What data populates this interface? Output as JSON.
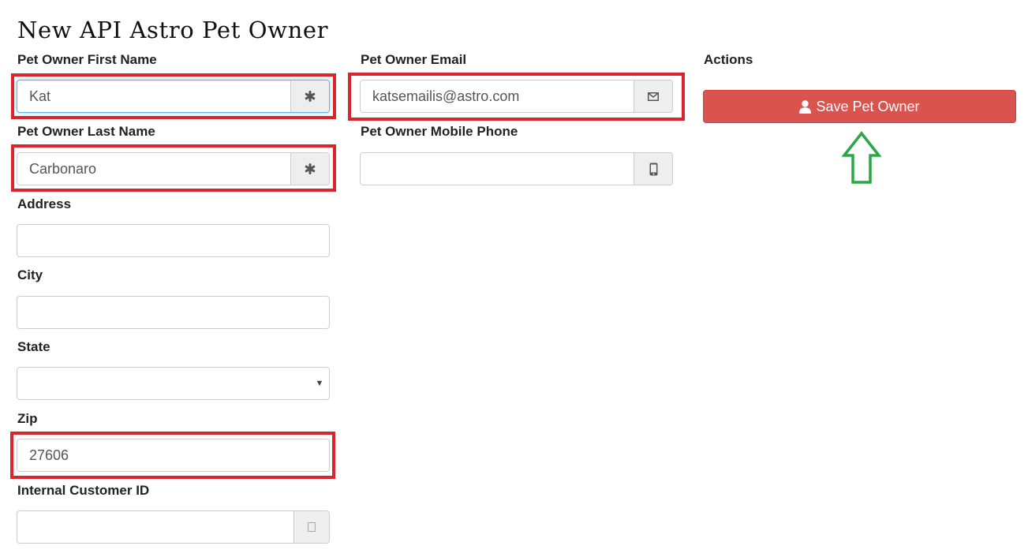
{
  "page": {
    "title": "New API Astro Pet Owner"
  },
  "form": {
    "first_name": {
      "label": "Pet Owner First Name",
      "value": "Kat",
      "icon": "asterisk-icon"
    },
    "last_name": {
      "label": "Pet Owner Last Name",
      "value": "Carbonaro",
      "icon": "asterisk-icon"
    },
    "address": {
      "label": "Address",
      "value": ""
    },
    "city": {
      "label": "City",
      "value": ""
    },
    "state": {
      "label": "State",
      "selected": ""
    },
    "zip": {
      "label": "Zip",
      "value": "27606"
    },
    "customer_id": {
      "label": "Internal Customer ID",
      "value": ""
    },
    "email": {
      "label": "Pet Owner Email",
      "value": "katsemailis@astro.com",
      "icon": "envelope-icon"
    },
    "mobile_phone": {
      "label": "Pet Owner Mobile Phone",
      "value": "",
      "icon": "phone-icon"
    }
  },
  "actions": {
    "label": "Actions",
    "save_label": "Save Pet Owner",
    "save_icon": "user-icon"
  },
  "colors": {
    "highlight": "#d9262e",
    "save_button": "#d9534f",
    "arrow": "#28a745",
    "focus_border": "#66afe9"
  }
}
